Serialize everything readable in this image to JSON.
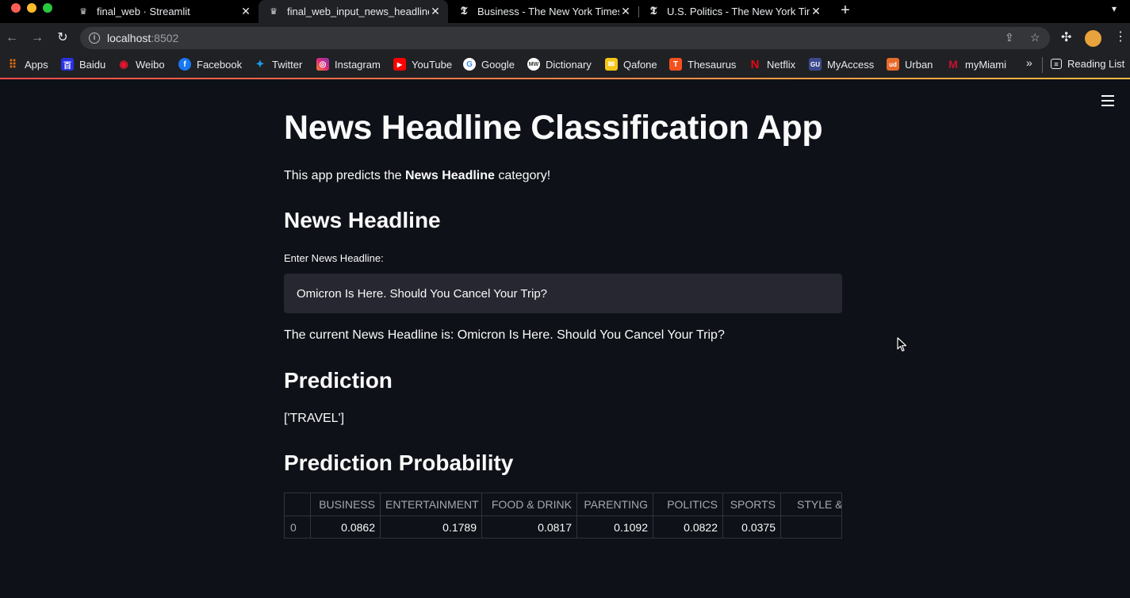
{
  "browser": {
    "tabs": [
      {
        "title": "final_web · Streamlit",
        "active": false
      },
      {
        "title": "final_web_input_news_headline",
        "active": true
      },
      {
        "title": "Business - The New York Times",
        "active": false
      },
      {
        "title": "U.S. Politics - The New York Times",
        "active": false
      }
    ],
    "address": {
      "host": "localhost",
      "port": ":8502"
    },
    "bookmarks": [
      "Apps",
      "Baidu",
      "Weibo",
      "Facebook",
      "Twitter",
      "Instagram",
      "YouTube",
      "Google",
      "Dictionary",
      "Qafone",
      "Thesaurus",
      "Netflix",
      "MyAccess",
      "Urban",
      "myMiami"
    ],
    "bookmarks_more": "»",
    "reading_list": "Reading List"
  },
  "app": {
    "title": "News Headline Classification App",
    "description": {
      "prefix": "This app predicts the ",
      "bold": "News Headline",
      "suffix": " category!"
    },
    "headline_section": {
      "heading": "News Headline",
      "input_label": "Enter News Headline:",
      "input_value": "Omicron Is Here. Should You Cancel Your Trip?",
      "current_text": "The current News Headline is: Omicron Is Here. Should You Cancel Your Trip?"
    },
    "prediction_section": {
      "heading": "Prediction",
      "value": "['TRAVEL']"
    },
    "probability_section": {
      "heading": "Prediction Probability",
      "table": {
        "index_header": "",
        "columns": [
          "BUSINESS",
          "ENTERTAINMENT",
          "FOOD & DRINK",
          "PARENTING",
          "POLITICS",
          "SPORTS",
          "STYLE & BEAUTY"
        ],
        "rows": [
          {
            "index": "0",
            "values": [
              "0.0862",
              "0.1789",
              "0.0817",
              "0.1092",
              "0.0822",
              "0.0375",
              ""
            ]
          }
        ]
      }
    }
  },
  "colors": {
    "background": "#0e1117",
    "text": "#fafafa",
    "input_bg": "#262730",
    "accent_start": "#ff4b4b",
    "accent_end": "#ffbd45"
  }
}
